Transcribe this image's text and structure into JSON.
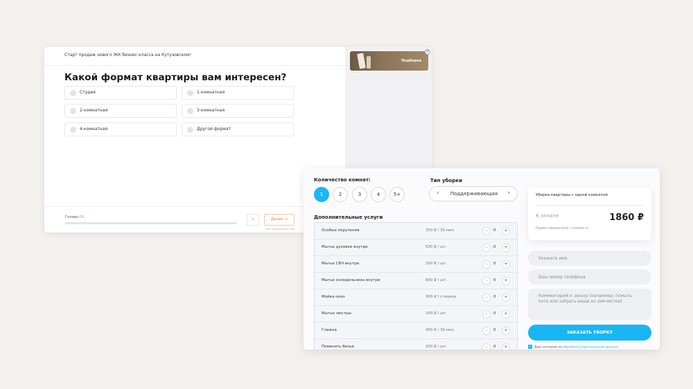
{
  "quiz": {
    "banner": "Старт продаж нового ЖК бизнес-класса на Кутузовском!",
    "promo_label": "Подборка",
    "close_icon": "×",
    "question": "Какой формат квартиры вам интересен?",
    "options": [
      "Студия",
      "1-комнатная",
      "2-комнатная",
      "3-комнатная",
      "4-комнатная",
      "Другой формат"
    ],
    "progress_label": "Готово:",
    "progress_value": "0%",
    "progress_fraction": 0,
    "prev_icon": "+",
    "next_label": "Далее →",
    "powered": "сайт-опросник by Enter"
  },
  "cleaning": {
    "rooms_title": "Количество комнат:",
    "rooms": [
      "1",
      "2",
      "3",
      "4",
      "5+"
    ],
    "rooms_selected": "1",
    "type_title": "Тип уборки",
    "type_value": "Поддерживающая",
    "type_prev": "‹",
    "type_next": "›",
    "extra_title": "Дополнительные услуги",
    "services": [
      {
        "name": "Особые поручения",
        "price": "350 ₽ / 30 мин",
        "qty": "0"
      },
      {
        "name": "Мытье духовки внутри",
        "price": "500 ₽ / шт.",
        "qty": "0"
      },
      {
        "name": "Мытье СВЧ внутри",
        "price": "300 ₽ / шт.",
        "qty": "0"
      },
      {
        "name": "Мытье холодильника внутри",
        "price": "800 ₽ / шт.",
        "qty": "0"
      },
      {
        "name": "Мойка окон",
        "price": "300 ₽ / створка",
        "qty": "0"
      },
      {
        "name": "Мытье люстры",
        "price": "300 ₽ / шт.",
        "qty": "0"
      },
      {
        "name": "Глажка",
        "price": "400 ₽ / 30 мин",
        "qty": "0"
      },
      {
        "name": "Поменять белье",
        "price": "200 ₽ / шт.",
        "qty": "0"
      }
    ],
    "minus": "-",
    "plus": "+",
    "summary": {
      "title": "Уборка квартиры с одной комнатой",
      "to_pay": "К оплате",
      "price": "1860 ₽",
      "note": "Ориентировочная стоимость"
    },
    "name_placeholder": "Укажите имя",
    "phone_placeholder": "Ваш номер телефона",
    "comment_placeholder": "Комментарий к заказу (например: помыть кота или забрать вещи из химчистки)",
    "order_button": "ЗАКАЗАТЬ УБОРКУ",
    "agree_text": "Даю согласие на",
    "agree_link": "обработку персональных данных",
    "check_icon": "✓"
  },
  "colors": {
    "accent_blue": "#18b6f2",
    "accent_orange": "#e8832e"
  }
}
